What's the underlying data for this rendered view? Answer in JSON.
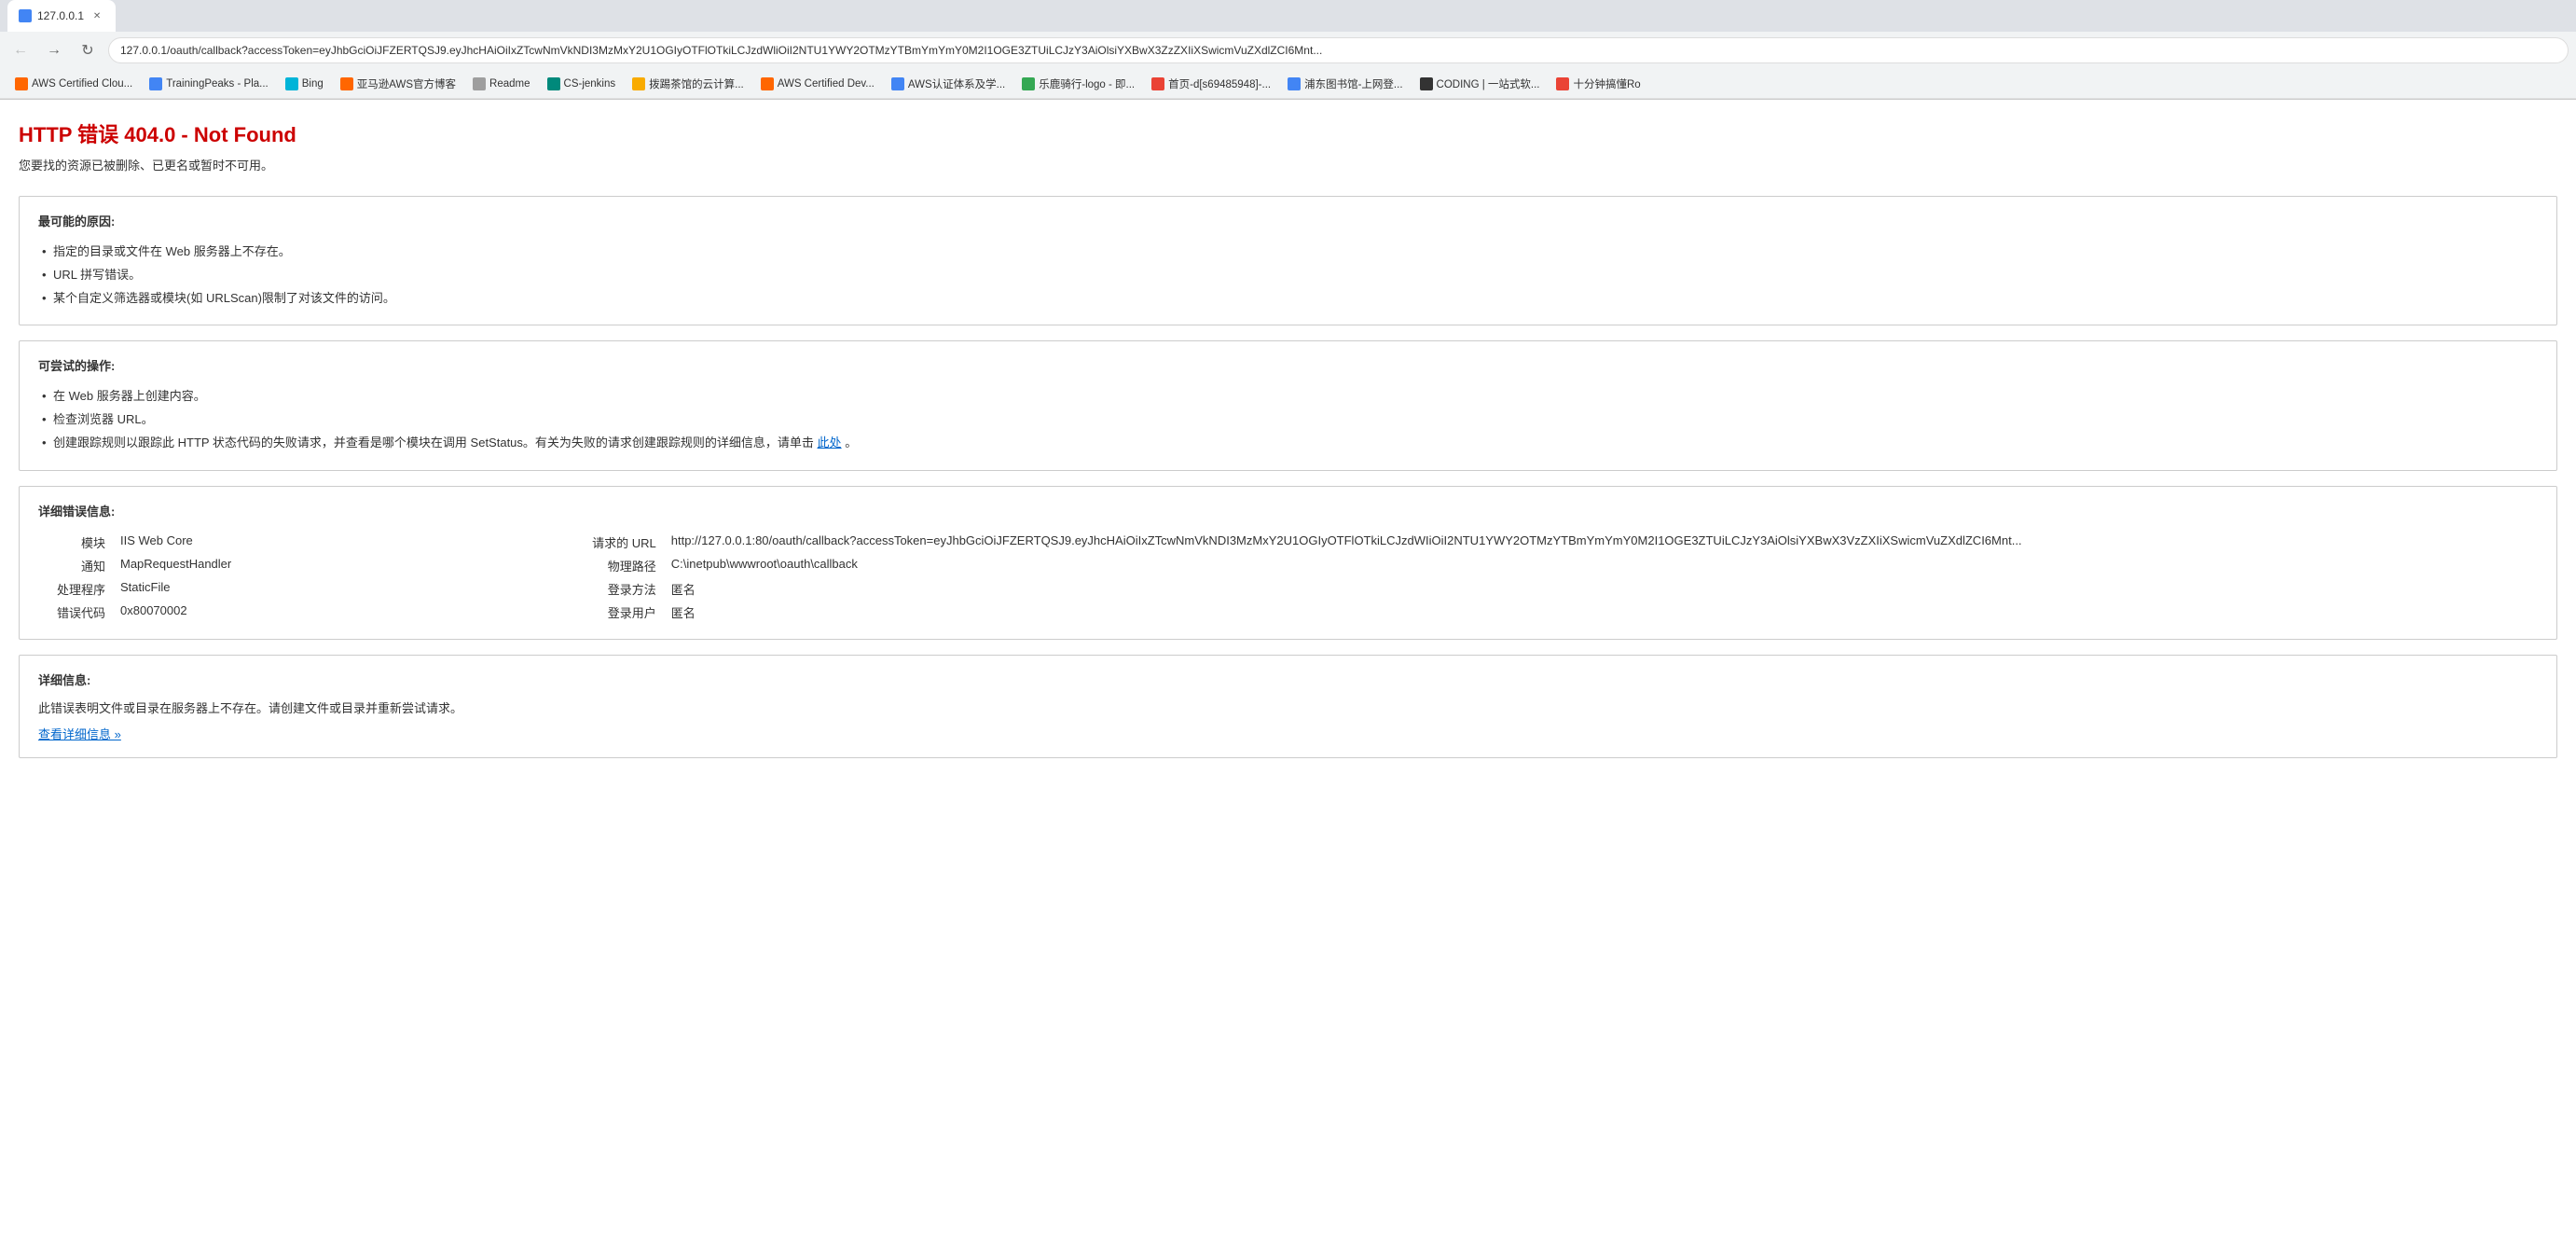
{
  "browser": {
    "url": "127.0.0.1/oauth/callback?accessToken=eyJhbGciOiJFZERTQSJ9.eyJhcHAiOiIxZTcwNmVkNDI3MzMxY2U1OGIyOTFlOTkiLCJzdWliOiI2NTU1YWY2OTMzYTBmYmYmY0M2I1OGE3ZTUiLCJzY3AiOlsiYXBwX3ZzZXIiXSwicmVuZXdlZCI6Mnt...",
    "tab_title": "127.0.0.1"
  },
  "bookmarks": [
    {
      "id": "bk1",
      "label": "AWS Certified Clou...",
      "color": "bk-orange"
    },
    {
      "id": "bk2",
      "label": "TrainingPeaks - Pla...",
      "color": "bk-blue"
    },
    {
      "id": "bk3",
      "label": "Bing",
      "color": "bk-light-blue"
    },
    {
      "id": "bk4",
      "label": "亚马逊AWS官方博客",
      "color": "bk-orange"
    },
    {
      "id": "bk5",
      "label": "Readme",
      "color": "bk-gray"
    },
    {
      "id": "bk6",
      "label": "CS-jenkins",
      "color": "bk-teal"
    },
    {
      "id": "bk7",
      "label": "拨踢茶馆的云计算...",
      "color": "bk-yellow"
    },
    {
      "id": "bk8",
      "label": "AWS Certified Dev...",
      "color": "bk-orange"
    },
    {
      "id": "bk9",
      "label": "AWS认证体系及学...",
      "color": "bk-blue"
    },
    {
      "id": "bk10",
      "label": "乐鹿骑行-logo - 即...",
      "color": "bk-green"
    },
    {
      "id": "bk11",
      "label": "首页-d[s69485948]-...",
      "color": "bk-red"
    },
    {
      "id": "bk12",
      "label": "浦东图书馆-上网登...",
      "color": "bk-blue"
    },
    {
      "id": "bk13",
      "label": "CODING | 一站式软...",
      "color": "bk-dark"
    },
    {
      "id": "bk14",
      "label": "十分钟搞懂Ro",
      "color": "bk-red"
    }
  ],
  "page": {
    "error_title": "HTTP 错误 404.0 - Not Found",
    "error_subtitle": "您要找的资源已被删除、已更名或暂时不可用。",
    "section1": {
      "title": "最可能的原因:",
      "items": [
        "指定的目录或文件在 Web 服务器上不存在。",
        "URL 拼写错误。",
        "某个自定义筛选器或模块(如 URLScan)限制了对该文件的访问。"
      ]
    },
    "section2": {
      "title": "可尝试的操作:",
      "items": [
        "在 Web 服务器上创建内容。",
        "检查浏览器 URL。",
        "创建跟踪规则以跟踪此 HTTP 状态代码的失败请求，并查看是哪个模块在调用 SetStatus。有关为失败的请求创建跟踪规则的详细信息，请单击此处。"
      ],
      "link_text": "此处",
      "item3_prefix": "创建跟踪规则以跟踪此 HTTP 状态代码的失败请求，并查看是哪个模块在调用 SetStatus。有关为失败的请求创建跟踪规则的详细信息，请单击",
      "item3_suffix": "。"
    },
    "section3": {
      "title": "详细错误信息:",
      "rows": [
        {
          "label": "模块",
          "value": "IIS Web Core"
        },
        {
          "label": "通知",
          "value": "MapRequestHandler"
        },
        {
          "label": "处理程序",
          "value": "StaticFile"
        },
        {
          "label": "错误代码",
          "value": "0x80070002"
        }
      ],
      "right_rows": [
        {
          "label": "请求的 URL",
          "value": "http://127.0.0.1:80/oauth/callback?accessToken=eyJhbGciOiJFZERTQSJ9.eyJhcHAiOiIxZTcwNmVkNDI3MzMxY2U1OGIyOTFlOTkiLCJzdWIiOiI2NTU1YWY2OTMzYTBmYmYmY0M2I1OGE3ZTUiLCJzY3AiOlsiYXBwX3VzZXIiXSwicmVuZXdlZCI6Mnt..."
        },
        {
          "label": "物理路径",
          "value": "C:\\inetpub\\wwwroot\\oauth\\callback"
        },
        {
          "label": "登录方法",
          "value": "匿名"
        },
        {
          "label": "登录用户",
          "value": "匿名"
        }
      ]
    },
    "section4": {
      "title": "详细信息:",
      "text": "此错误表明文件或目录在服务器上不存在。请创建文件或目录并重新尝试请求。",
      "link_text": "查看详细信息 »"
    }
  }
}
